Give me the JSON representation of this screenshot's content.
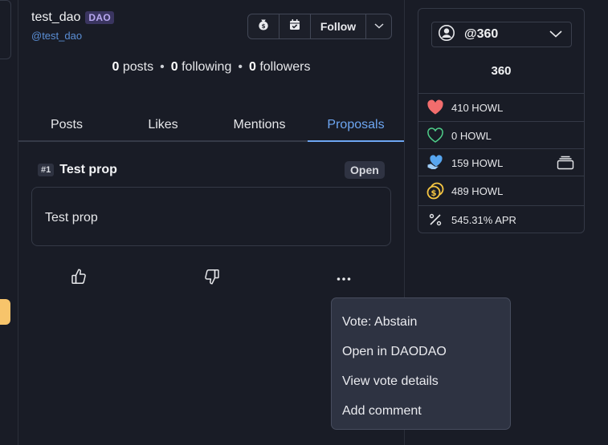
{
  "profile": {
    "display_name": "test_dao",
    "badge": "DAO",
    "username": "@test_dao",
    "follow_label": "Follow"
  },
  "stats": {
    "posts_count": "0",
    "posts_label": "posts",
    "following_count": "0",
    "following_label": "following",
    "followers_count": "0",
    "followers_label": "followers"
  },
  "tabs": [
    {
      "label": "Posts"
    },
    {
      "label": "Likes"
    },
    {
      "label": "Mentions"
    },
    {
      "label": "Proposals",
      "active": true
    }
  ],
  "proposal": {
    "number": "#1",
    "title": "Test prop",
    "status": "Open",
    "body": "Test prop"
  },
  "menu": {
    "items": [
      "Vote: Abstain",
      "Open in DAODAO",
      "View vote details",
      "Add comment"
    ]
  },
  "sidebar": {
    "account_label": "@360",
    "power_value": "360",
    "balances": [
      {
        "icon": "heart-filled-icon",
        "value": "410 HOWL"
      },
      {
        "icon": "heart-outline-icon",
        "value": "0 HOWL"
      },
      {
        "icon": "heart-hand-icon",
        "value": "159 HOWL"
      },
      {
        "icon": "coins-icon",
        "value": "489 HOWL"
      },
      {
        "icon": "percent-icon",
        "value": "545.31% APR"
      }
    ]
  },
  "colors": {
    "background": "#191c26",
    "accent": "#6da6f2",
    "heart": "#f26d6d",
    "heart_outline": "#4fcf8a",
    "heart_hand": "#57a6f0",
    "coin": "#f5c542"
  }
}
